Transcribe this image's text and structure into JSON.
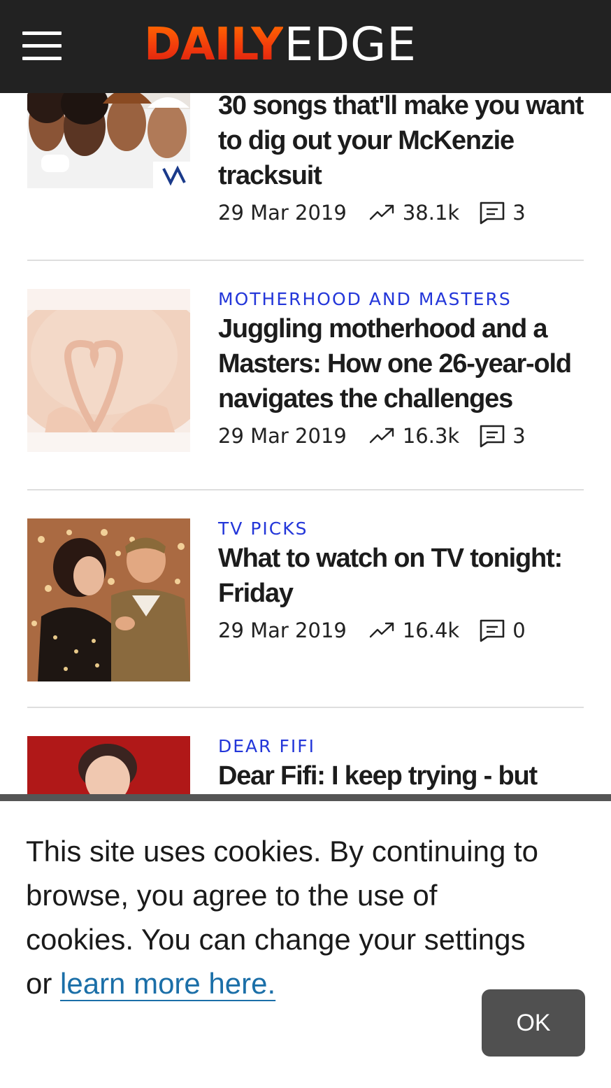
{
  "header": {
    "menu_label": "Menu",
    "logo_part1": "DAILY",
    "logo_part2": "EDGE"
  },
  "articles": [
    {
      "category": "",
      "headline": "30 songs that'll make you want to dig out your McKenzie tracksuit",
      "date": "29 Mar 2019",
      "views": "38.1k",
      "comments": "3"
    },
    {
      "category": "MOTHERHOOD AND MASTERS",
      "headline": "Juggling motherhood and a Masters: How one 26-year-old navigates the challenges",
      "date": "29 Mar 2019",
      "views": "16.3k",
      "comments": "3"
    },
    {
      "category": "TV PICKS",
      "headline": "What to watch on TV tonight: Friday",
      "date": "29 Mar 2019",
      "views": "16.4k",
      "comments": "0"
    },
    {
      "category": "DEAR FIFI",
      "headline": "Dear Fifi: I keep trying - but"
    }
  ],
  "cookie": {
    "text": "This site uses cookies. By continuing to browse, you agree to the use of cookies. You can change your settings or ",
    "link": "learn more here.",
    "ok_label": "OK"
  },
  "icons": {
    "trend": "trending-up-icon",
    "comments": "comment-icon",
    "menu": "hamburger-menu-icon"
  },
  "colors": {
    "header_bg": "#222222",
    "category": "#2336d9",
    "link": "#1b6fa8",
    "ok_button": "#505050"
  }
}
